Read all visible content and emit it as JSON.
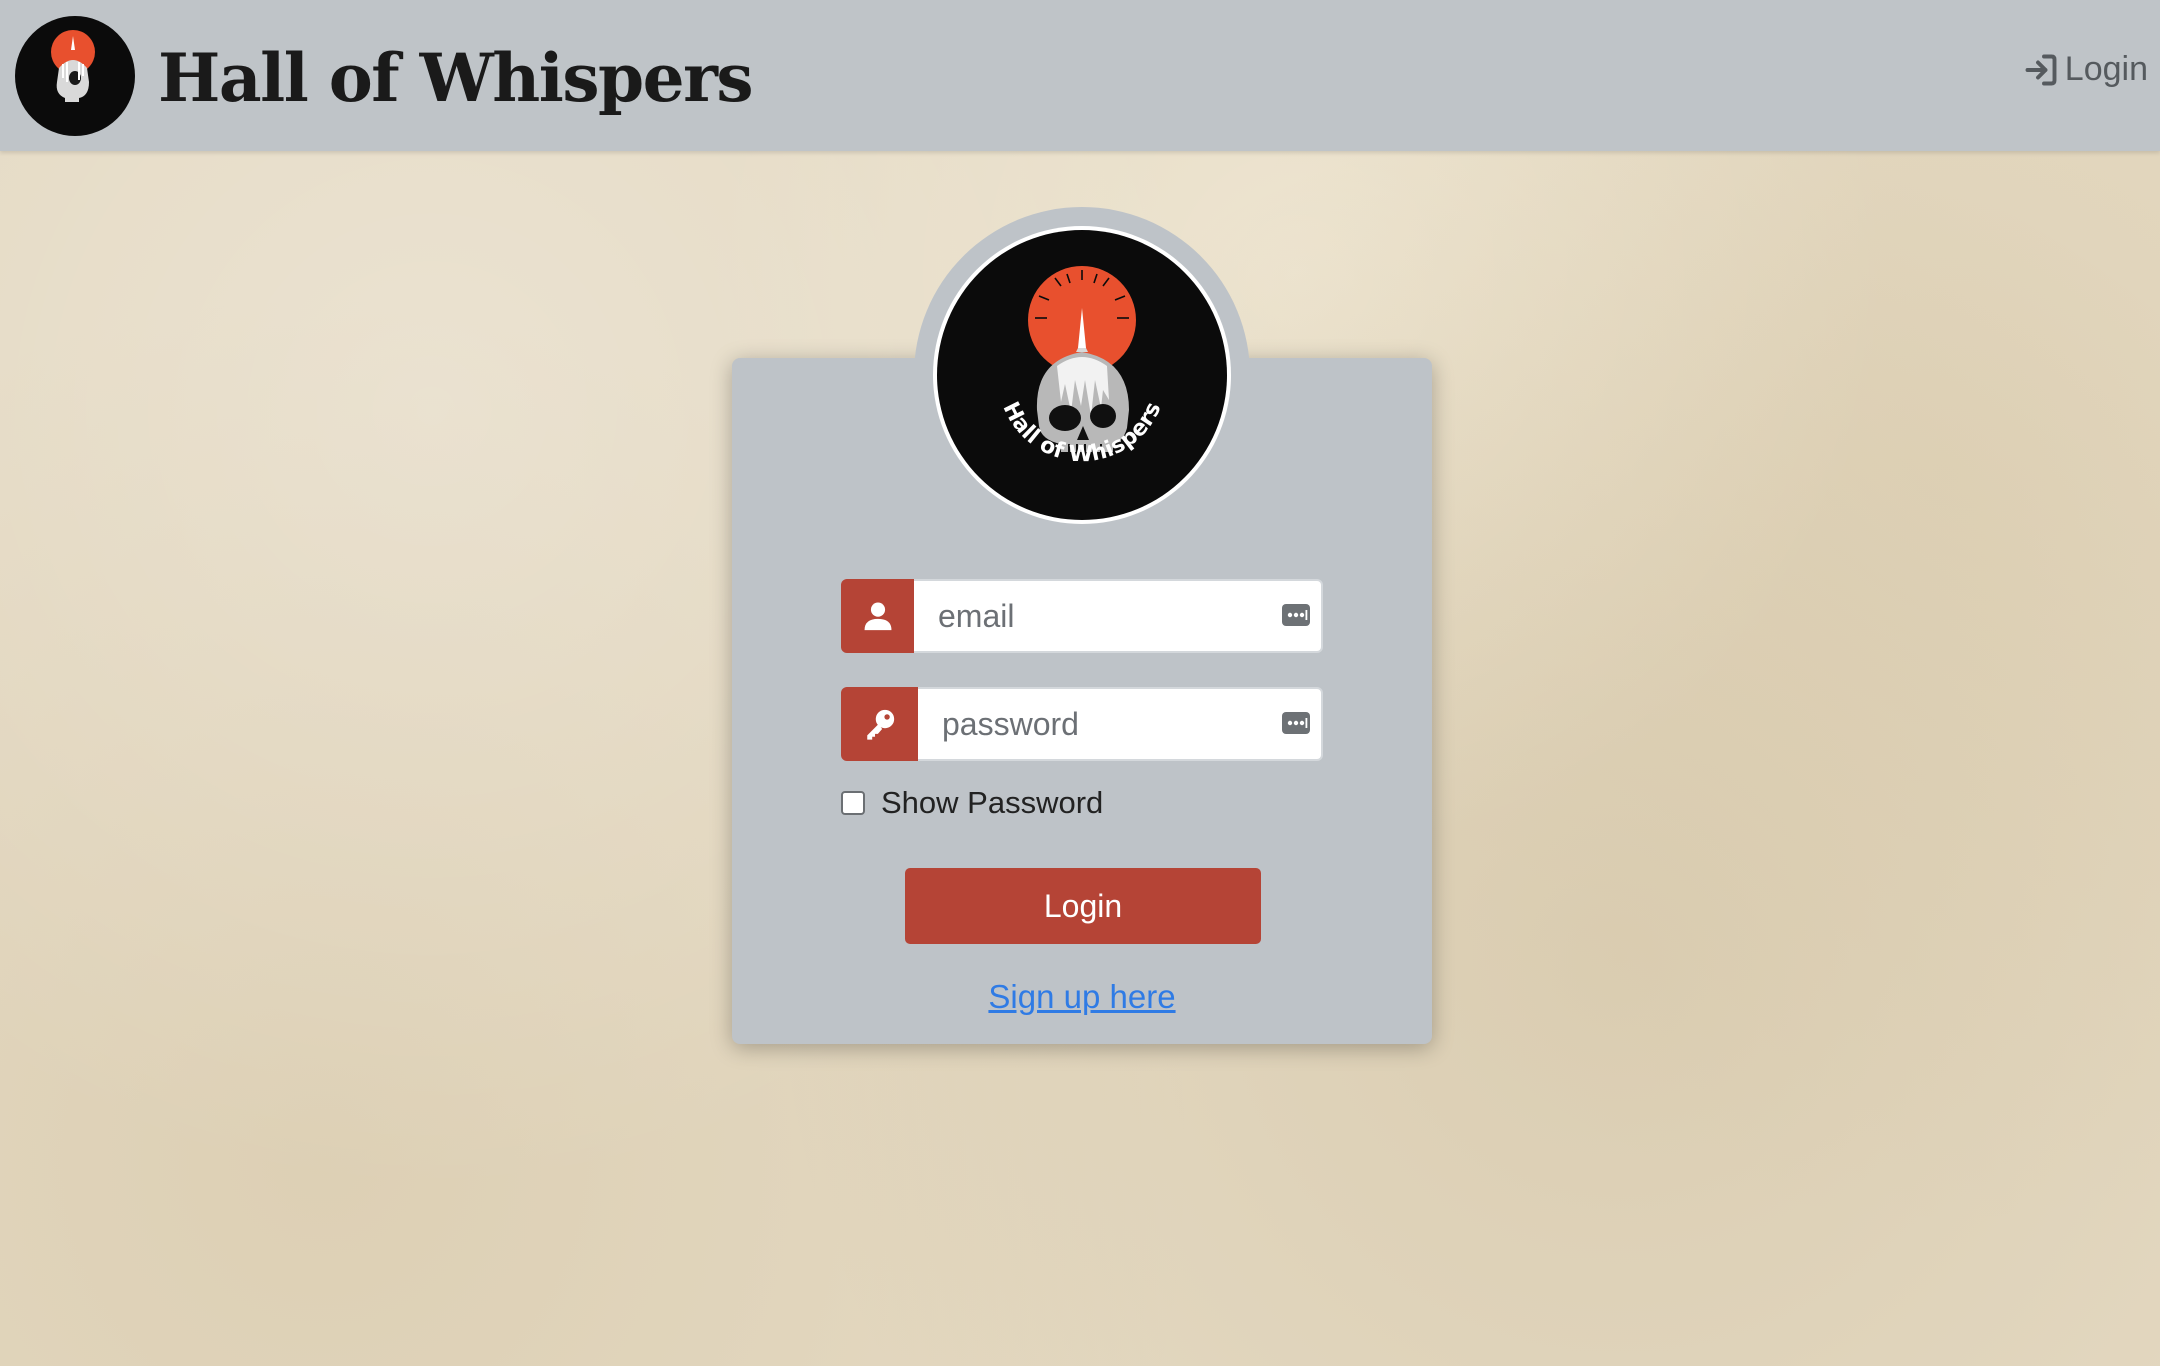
{
  "navbar": {
    "title": "Hall of Whispers",
    "login_label": "Login"
  },
  "logo": {
    "caption": "Hall of Whispers"
  },
  "form": {
    "email_placeholder": "email",
    "email_value": "",
    "password_placeholder": "password",
    "password_value": "",
    "show_password_label": "Show Password",
    "show_password_checked": false,
    "login_button": "Login",
    "signup_link": "Sign up here"
  },
  "icons": {
    "nav_login": "sign-in-icon",
    "email_addon": "user-icon",
    "password_addon": "key-icon",
    "autofill": "password-autofill-icon"
  },
  "colors": {
    "navbar_bg": "#bfc4c8",
    "card_bg": "#bec3c8",
    "accent": "#b54436",
    "link": "#2f7be5",
    "logo_sun": "#e8502e",
    "page_bg": "#e4d9c2"
  }
}
